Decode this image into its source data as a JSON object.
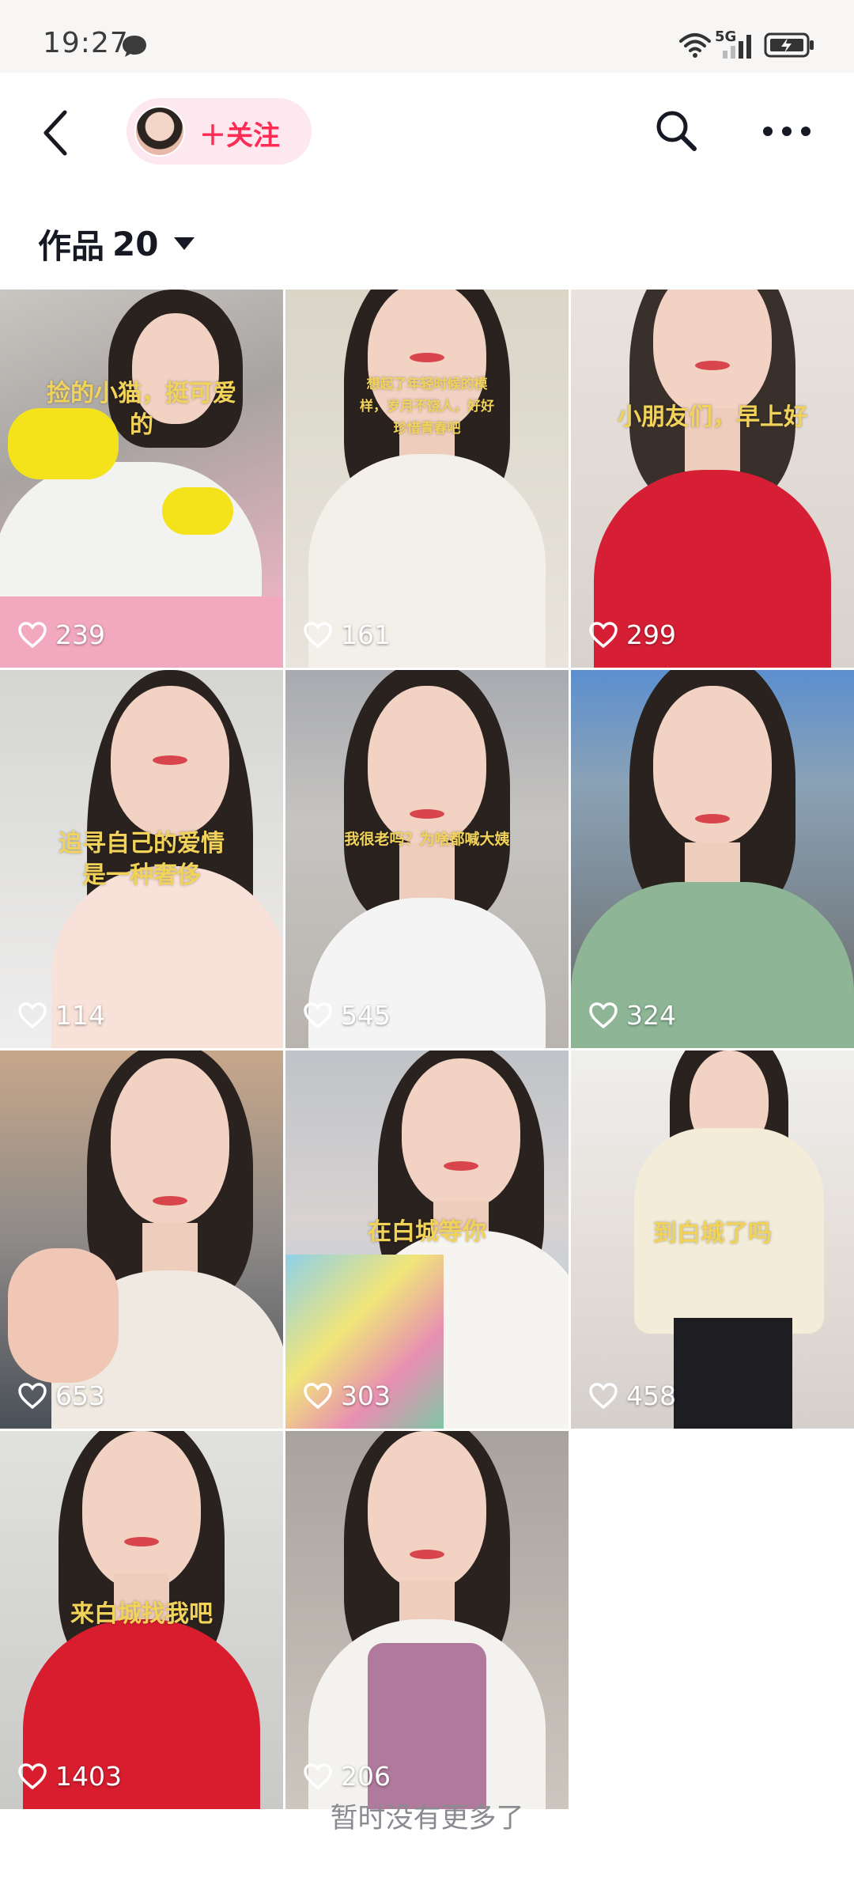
{
  "status_bar": {
    "time": "19:27",
    "network": "5G",
    "icons": [
      "message-icon",
      "wifi-icon",
      "signal-icon",
      "battery-charging-icon"
    ]
  },
  "header": {
    "follow_label": "＋关注",
    "icons": [
      "back-arrow-icon",
      "search-icon",
      "more-dots-icon"
    ]
  },
  "works": {
    "label": "作品",
    "count": "20"
  },
  "videos": [
    {
      "likes": "239",
      "caption": "捡的小猫，挺可爱的"
    },
    {
      "likes": "161",
      "caption": "想起了年轻时候的模样，岁月不饶人，好好珍惜青春吧"
    },
    {
      "likes": "299",
      "caption": "小朋友们，早上好"
    },
    {
      "likes": "114",
      "caption": "追寻自己的爱情是一种奢侈"
    },
    {
      "likes": "545",
      "caption": "我很老吗？为啥都喊大姨"
    },
    {
      "likes": "324",
      "caption": ""
    },
    {
      "likes": "653",
      "caption": ""
    },
    {
      "likes": "303",
      "caption": "在白城等你"
    },
    {
      "likes": "458",
      "caption": "到白城了吗"
    },
    {
      "likes": "1403",
      "caption": "来白城找我吧"
    },
    {
      "likes": "206",
      "caption": ""
    }
  ],
  "footer": {
    "no_more": "暂时没有更多了"
  },
  "colors": {
    "accent": "#fe2c55",
    "follow_pill_bg": "#fce8ee",
    "caption_yellow": "#f2d35a",
    "muted_text": "#8a8b91"
  }
}
